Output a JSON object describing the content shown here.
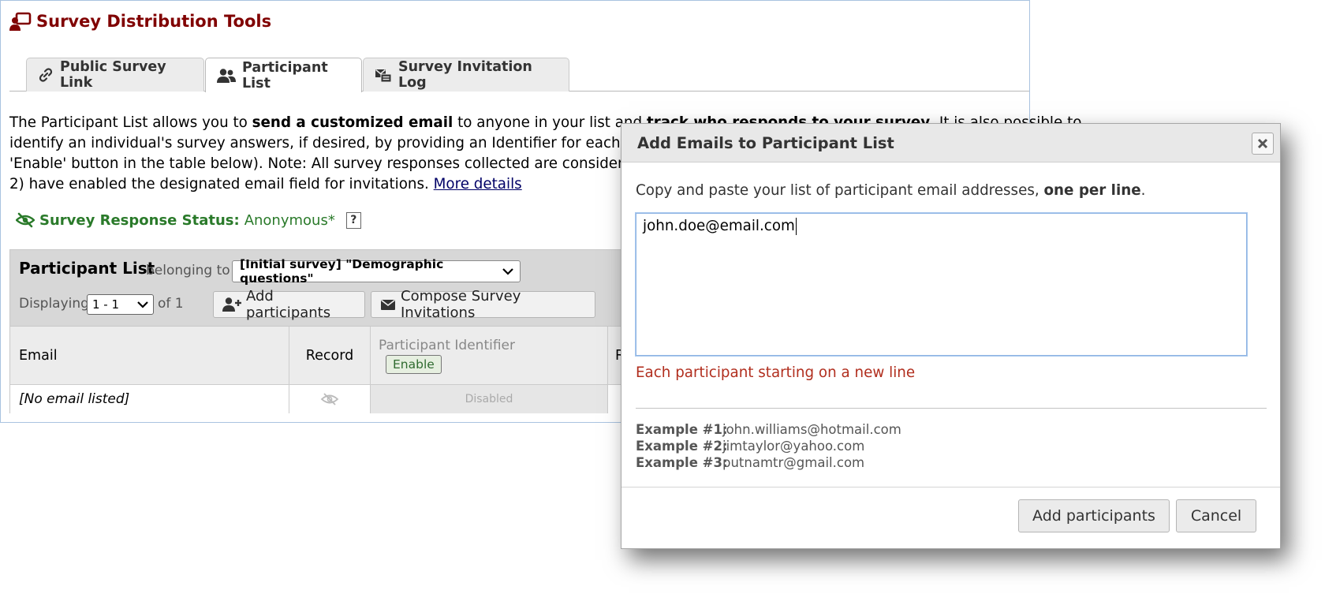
{
  "panel": {
    "title": "Survey Distribution Tools",
    "tabs": [
      {
        "label": "Public Survey Link",
        "icon": "link-icon",
        "active": false
      },
      {
        "label": "Participant List",
        "icon": "users-icon",
        "active": true
      },
      {
        "label": "Survey Invitation Log",
        "icon": "mail-log-icon",
        "active": false
      }
    ],
    "intro": {
      "line1_a": "The Participant List allows you to ",
      "line1_b": "send a customized email",
      "line1_c": " to anyone in your list and ",
      "line1_d": "track who responds to your survey",
      "line1_e": ". It is also possible to",
      "line2": "identify an individual's survey answers, if desired, by providing an Identifier for each participant (click the",
      "line3": "'Enable' button in the table below). Note: All survey responses collected are considered anonymous unless you",
      "line4": "2) have enabled the designated email field for invitations. ",
      "more_details": "More details"
    },
    "status": {
      "label": "Survey Response Status:",
      "value": "Anonymous*",
      "help": "?"
    },
    "participant_list": {
      "title": "Participant List",
      "belonging_to": "belonging to",
      "survey_select": "[Initial survey] \"Demographic questions\"",
      "displaying": "Displaying",
      "page_select": "1 - 1",
      "of": "of 1",
      "add_button": "Add participants",
      "compose_button": "Compose Survey Invitations",
      "columns": {
        "email": "Email",
        "record": "Record",
        "identifier": "Participant Identifier",
        "enable": "Enable",
        "next_partial": "R"
      },
      "rows": [
        {
          "email": "[No email listed]",
          "identifier": "Disabled"
        }
      ]
    }
  },
  "dialog": {
    "title": "Add Emails to Participant List",
    "instruction": "Copy and paste your list of participant email addresses, ",
    "instruction_bold": "one per line",
    "instruction_end": ".",
    "textarea_value": "john.doe@email.com",
    "hint": "Each participant starting on a new line",
    "examples": [
      {
        "label": "Example #1:",
        "value": "john.williams@hotmail.com"
      },
      {
        "label": "Example #2:",
        "value": "jimtaylor@yahoo.com"
      },
      {
        "label": "Example #3:",
        "value": "putnamtr@gmail.com"
      }
    ],
    "add_button": "Add participants",
    "cancel_button": "Cancel"
  },
  "colors": {
    "title_red": "#800000",
    "status_green": "#2a7a2a",
    "hint_red": "#b12e1e",
    "link_blue": "#000066"
  }
}
